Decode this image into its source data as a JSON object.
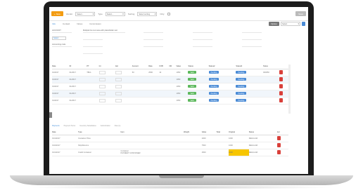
{
  "toolbar": {
    "new_label": "New",
    "filter1_label": "Vendor",
    "filter1_value": "Select...",
    "filter2_label": "Type",
    "filter2_value": "Select...",
    "filter3_label": "Sorting",
    "filter3_value": "Select sorting",
    "filter4_label": "Only",
    "right_button": "Save"
  },
  "tabs": [
    "Info",
    "Contact",
    "Notes",
    "Commission"
  ],
  "right_controls": {
    "dark_button": "Option",
    "select_value": "Select"
  },
  "form": {
    "fields": [
      "ACCOUNT",
      "Select",
      "Accounting code",
      "Accounting code"
    ],
    "textbox": "Multiple line text area with placeholder text",
    "pct": "%"
  },
  "grid": {
    "headers": [
      "Date",
      "ID",
      "PT",
      "Int",
      "Ext",
      "Amount",
      "Rate",
      "FOB",
      "OD",
      "Value",
      "Status",
      "Status2",
      "Status3",
      "Notes"
    ],
    "rows": [
      {
        "date": "01/2017",
        "id": "01/2017",
        "pt": "TBCL",
        "amount": "50",
        "rate": "2500",
        "fob": "10",
        "val": "1050",
        "s1": "Valid",
        "s2": "Pending",
        "s3": "Pending",
        "note": "000050",
        "alt": false
      },
      {
        "date": "01/2017",
        "id": "01/2017",
        "val": "1050",
        "s1": "Valid",
        "s2": "Pending",
        "s3": "Pending",
        "alt": true
      },
      {
        "date": "01/2017",
        "id": "01/2017",
        "val": "1050",
        "s1": "Valid",
        "s2": "Pending",
        "s3": "Pending",
        "alt": false
      },
      {
        "date": "01/2017",
        "id": "01/2017",
        "val": "1050",
        "s1": "Valid",
        "s2": "Pending",
        "s3": "Pending",
        "alt": true
      },
      {
        "date": "01/2017",
        "id": "01/2017",
        "val": "1050",
        "s1": "Valid",
        "s2": "Pending",
        "s3": "Pending",
        "alt": false
      }
    ]
  },
  "bottom_tabs": [
    "Payments",
    "Payment Terms",
    "Inventory Subsidiaries",
    "Authorization",
    "Files (1)"
  ],
  "bottom_grid": {
    "headers": [
      "Date",
      "Type",
      "Item",
      "Weight",
      "Value",
      "Total",
      "Original",
      "Status",
      "Act"
    ],
    "rows": [
      {
        "date": "01/1/2017",
        "type": "Container Price",
        "item": "",
        "weight": "",
        "value": "2000",
        "total": "",
        "original": "1000",
        "status": "REGULAR",
        "value_red": true,
        "yellow": false
      },
      {
        "date": "01/2/2017",
        "type": "Ship/Returns",
        "item": "",
        "weight": "",
        "value": "7500",
        "total": "",
        "original": "1000",
        "status": "REGULAR",
        "value_red": false,
        "yellow": false
      },
      {
        "date": "01/1/2017",
        "type": "Credit Container",
        "item": "Container",
        "item2": "PAYMENT CONTAINER",
        "weight": "",
        "value": "2500",
        "total": "",
        "original": "1000",
        "status": "REGULAR",
        "value_red": false,
        "yellow": true
      }
    ]
  }
}
